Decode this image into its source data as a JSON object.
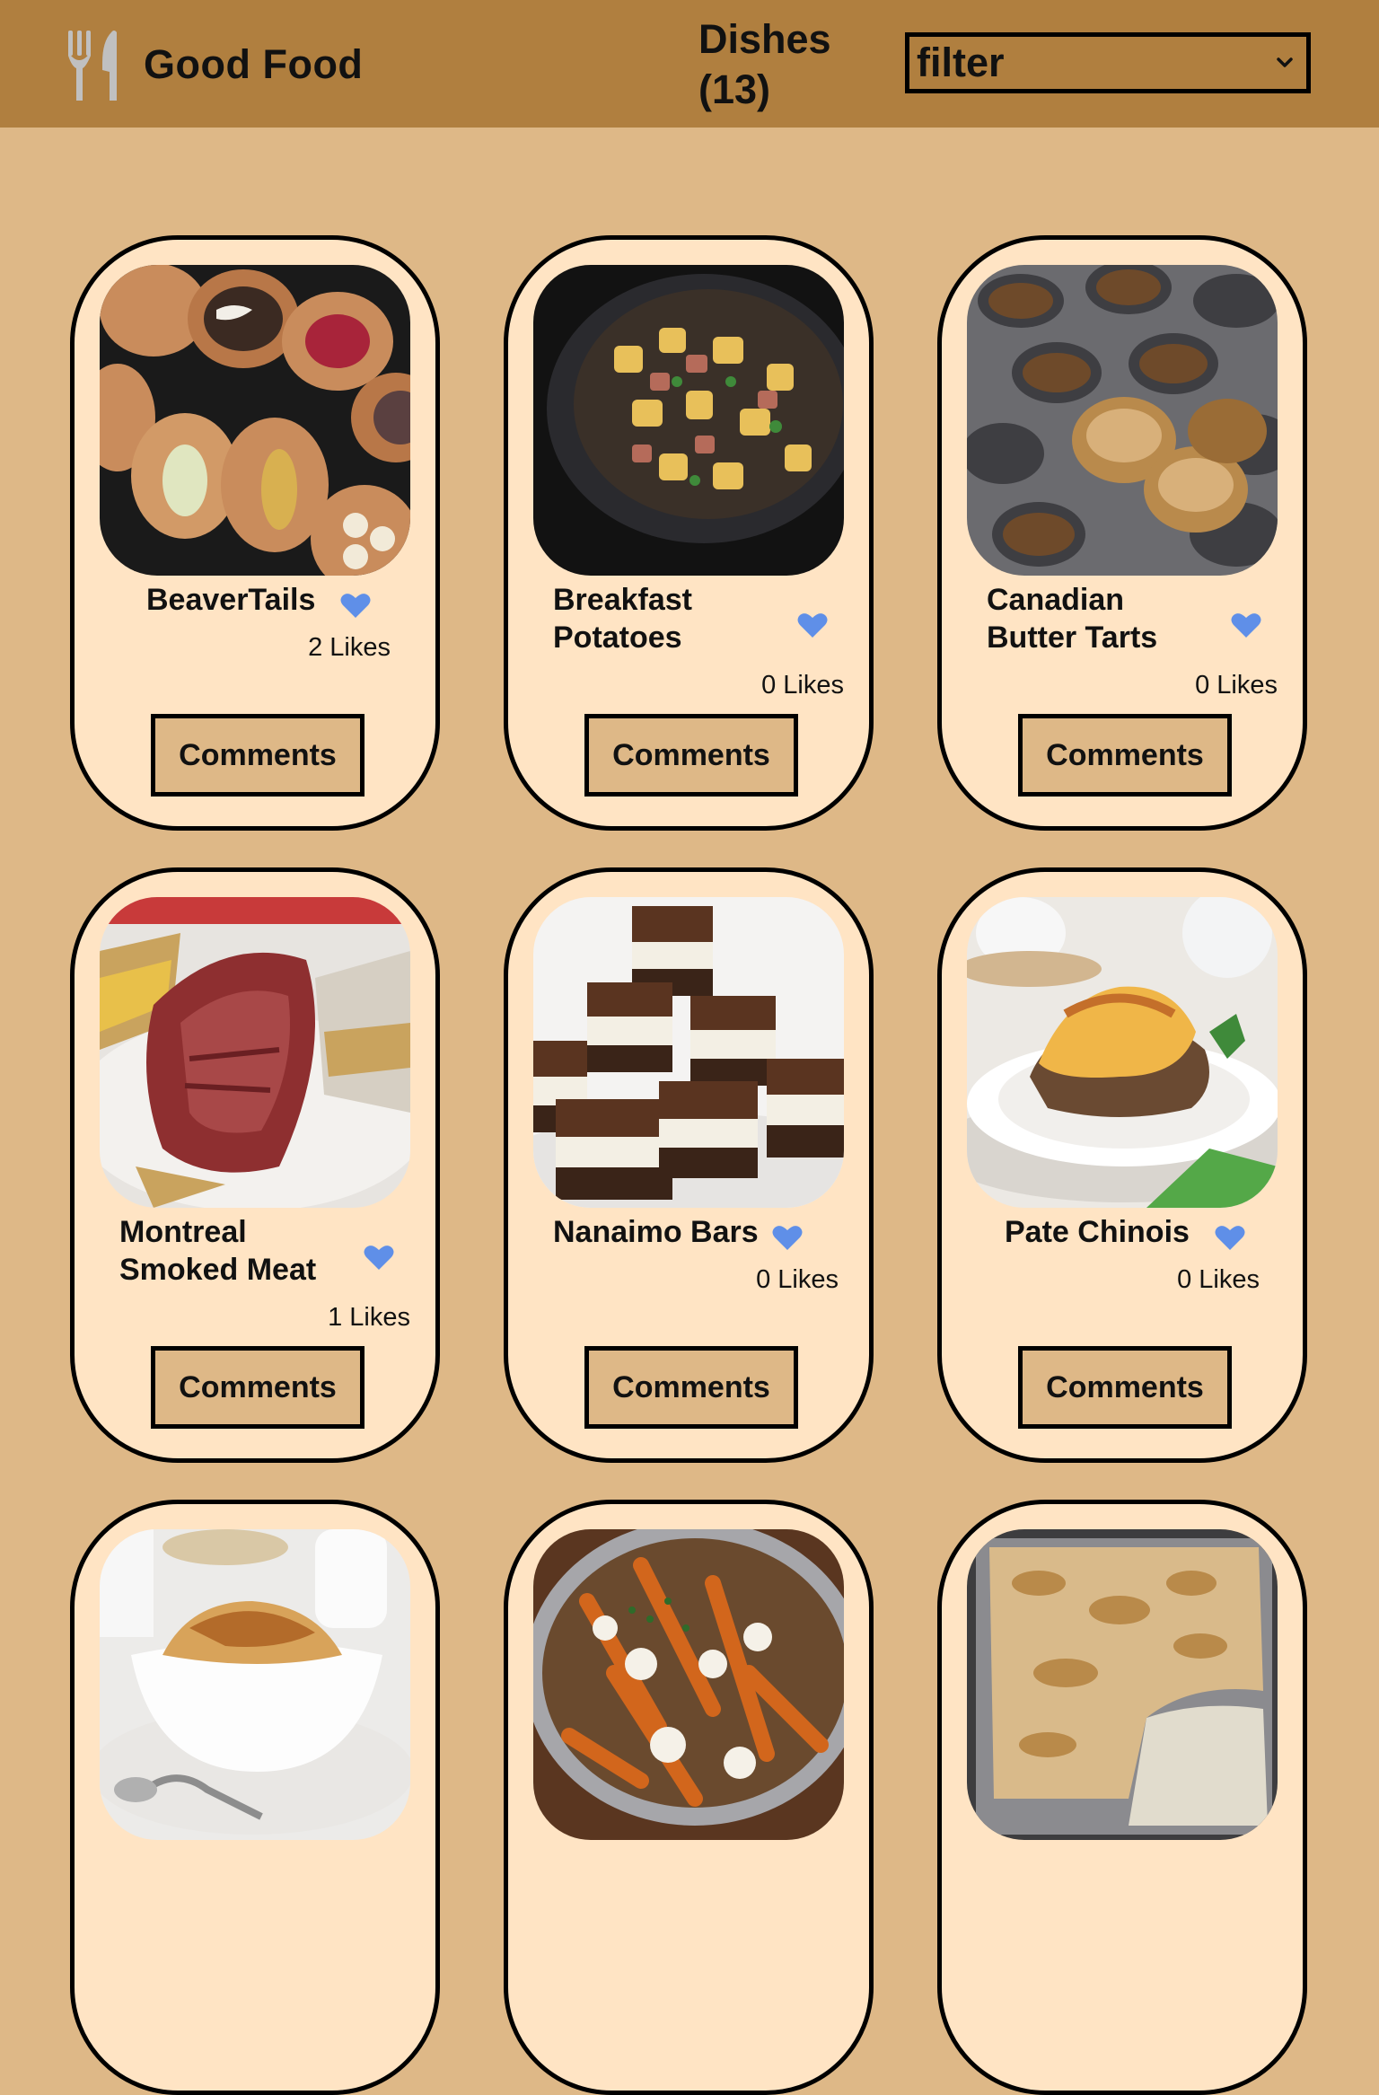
{
  "header": {
    "app_name": "Good Food",
    "dishes_title": "Dishes (13)",
    "filter_value": "filter",
    "colors": {
      "header_bg": "#b07f3f",
      "page_bg": "#deb887",
      "card_bg": "#ffe4c4",
      "heart": "#5f8fe8"
    }
  },
  "dishes": [
    {
      "name": "BeaverTails",
      "likes": "2 Likes",
      "button": "Comments"
    },
    {
      "name": "Breakfast Potatoes",
      "likes": "0 Likes",
      "button": "Comments"
    },
    {
      "name": "Canadian Butter Tarts",
      "likes": "0 Likes",
      "button": "Comments"
    },
    {
      "name": "Montreal Smoked Meat",
      "likes": "1 Likes",
      "button": "Comments"
    },
    {
      "name": "Nanaimo Bars",
      "likes": "0 Likes",
      "button": "Comments"
    },
    {
      "name": "Pate Chinois",
      "likes": "0 Likes",
      "button": "Comments"
    },
    {
      "name": "",
      "likes": "",
      "button": ""
    },
    {
      "name": "",
      "likes": "",
      "button": ""
    },
    {
      "name": "",
      "likes": "",
      "button": ""
    }
  ]
}
